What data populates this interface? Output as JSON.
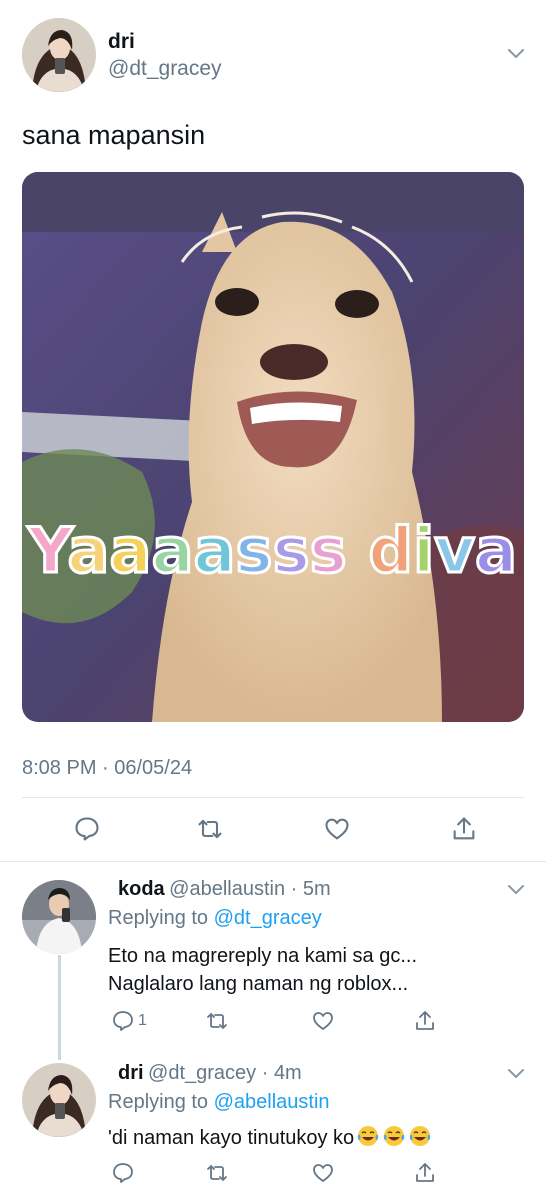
{
  "main_tweet": {
    "name": "dri",
    "handle": "@dt_gracey",
    "text": "sana mapansin",
    "media": {
      "caption": "Yaaaasss diva",
      "caption_colors": [
        "#f4a7c8",
        "#f6d27a",
        "#f4d25a",
        "#9ad4a2",
        "#6ec6d8",
        "#7fb5e8",
        "#a99be6",
        "#e8a0d0",
        "#f2a27a",
        "#a3d36a",
        "#8bc7e8",
        "#9b8ee6",
        "#c89ae6"
      ]
    },
    "timestamp": "8:08 PM · 06/05/24",
    "actions": [
      "reply-icon",
      "retweet-icon",
      "like-icon",
      "share-icon"
    ]
  },
  "replies": [
    {
      "name": "koda",
      "handle": "@abellaustin",
      "time": "5m",
      "replying_label": "Replying to",
      "replying_to": "@dt_gracey",
      "line1": "Eto na magrereply na kami sa gc...",
      "line2": "Naglalaro lang naman ng roblox...",
      "reply_count": "1"
    },
    {
      "name": "dri",
      "handle": "@dt_gracey",
      "time": "4m",
      "replying_label": "Replying to",
      "replying_to": "@abellaustin",
      "text": "'di naman kayo tinutukoy ko"
    }
  ],
  "colors": {
    "text": "#0f1419",
    "secondary": "#657786",
    "link": "#1da1f2",
    "divider": "#e1e8ed"
  }
}
